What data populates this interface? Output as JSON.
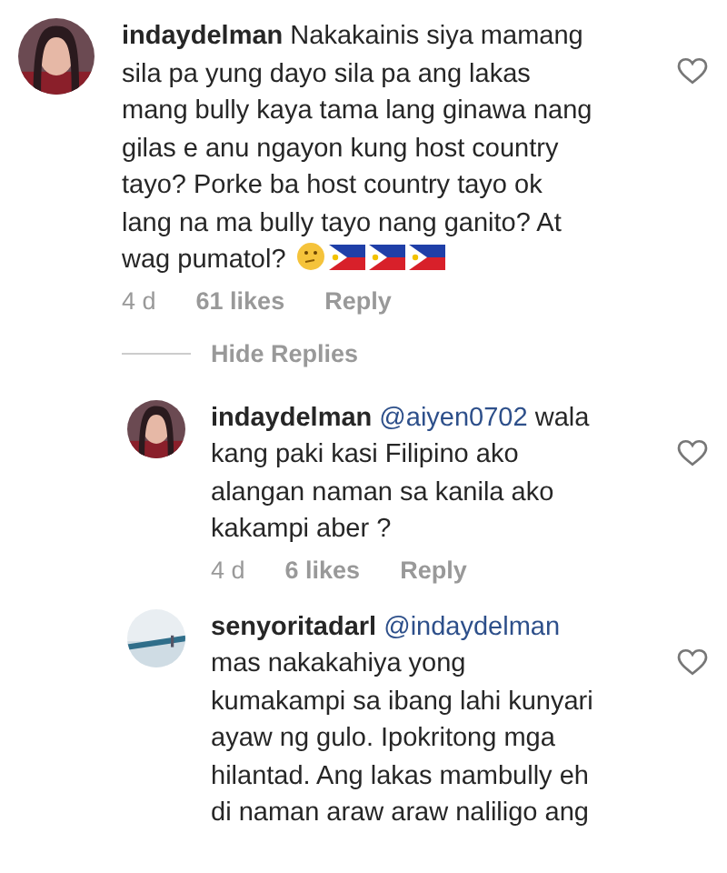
{
  "comments": [
    {
      "username": "indaydelman",
      "text": "Nakakainis siya mamang\nsila pa yung dayo sila pa ang lakas\nmang bully kaya tama lang ginawa nang\ngilas e anu ngayon kung host country\ntayo? Porke ba host country tayo ok\nlang na ma bully tayo nang ganito? At\nwag pumatol?",
      "emoji": true,
      "time": "4 d",
      "likes": "61 likes",
      "reply": "Reply",
      "liked": false
    },
    {
      "kind": "hide",
      "label": "Hide Replies"
    },
    {
      "username": "indaydelman",
      "mention": "@aiyen0702",
      "text": "wala\nkang paki kasi Filipino ako\nalangan naman sa kanila ako\nkakampi aber ?",
      "time": "4 d",
      "likes": "6 likes",
      "reply": "Reply",
      "liked": false
    },
    {
      "username": "senyoritadarl",
      "mention": "@indaydelman",
      "text": "\nmas nakakahiya yong\nkumakampi sa ibang lahi kunyari\nayaw ng gulo. Ipokritong mga\nhilantad. Ang lakas mambully eh\ndi naman araw araw naliligo ang",
      "liked": false
    }
  ]
}
